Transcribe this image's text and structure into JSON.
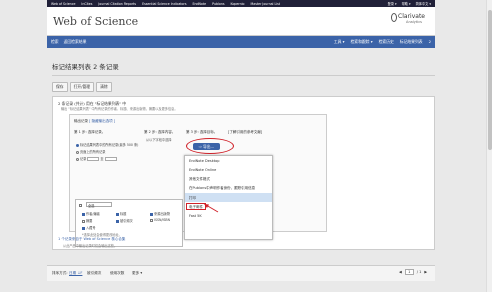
{
  "topbar": {
    "links": [
      "Web of Science",
      "InCites",
      "Journal Citation Reports",
      "Essential Science Indicators",
      "EndNote",
      "Publons",
      "Kopernio",
      "Master Journal List"
    ],
    "right": [
      "登录 ▾",
      "帮助 ▾",
      "简体中文 ▾"
    ]
  },
  "header": {
    "logo": "Web of Science",
    "clarivate_name": "Clarivate",
    "clarivate_sub": "Analytics"
  },
  "nav": {
    "left": [
      "检索",
      "返回检索结果"
    ],
    "right": [
      "工具 ▾",
      "检索和跟踪 ▾",
      "检索历史",
      "标记结果列表",
      "2"
    ]
  },
  "page_title": "标记结果列表 2 条记录",
  "toolbar": [
    "保存",
    "打开/管理",
    "清除"
  ],
  "panel": {
    "title": "2 条记录 (共计) 用在 \"标记结果列表\" 中",
    "desc": "输出 \"标记结果列表\" 中所有记录的作者、标题、来源出版物，摘要以及更多信息。",
    "output_label": "输出记录",
    "hide_link": "[ 隐藏输出选项 ]",
    "step1": "第 1 步: 选择记录。",
    "step2": "第 2 步: 选择内容。",
    "step3": "第 3 步: 选择目标。",
    "step3_link": "[了解引用的参考文献]",
    "opt_all": "标记结果列表中的所有记录(最多 500 条)",
    "opt_page": "页面上的所有记录",
    "opt_records": "记录",
    "opt_to": "至",
    "step2_desc": "从以下字段中选择",
    "select_value": "全选",
    "fields": [
      "作者/编者",
      "标题",
      "来源出版物",
      "摘要",
      "被引频次",
      "ISSN/ISBN",
      "入藏号"
    ],
    "fields_note": "*选择此处会使得更改地址。"
  },
  "send_button": "导出...",
  "menu_items": [
    "EndNote Desktop",
    "EndNote Online",
    "其他文件格式",
    "在Publons中声明作者身份，跟踪引用信息",
    "打印",
    "电子邮件",
    "Fast 5K"
  ],
  "footer_link": "1 个记录来自于 Web of Science 核心合集",
  "footer_note": "从此产品中输出记录时仅会输出这些。",
  "bottom": {
    "sort_label": "排序方式:",
    "sort_options": [
      "日期 ↓F",
      "被引频次",
      "使用次数",
      "更多 ▾"
    ],
    "page_current": "1",
    "page_total": "/ 1"
  }
}
